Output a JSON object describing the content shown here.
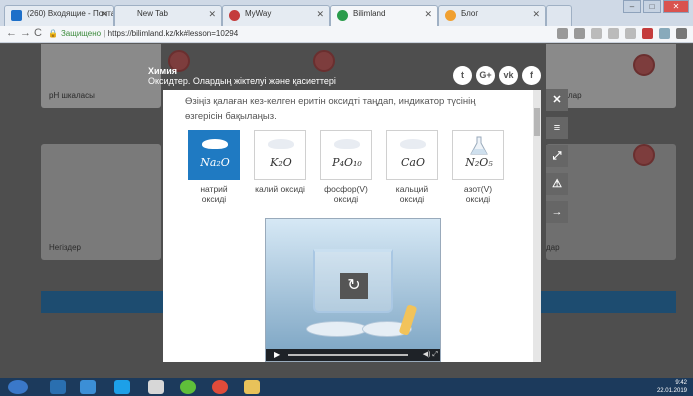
{
  "browser": {
    "tabs": [
      {
        "label": "(260) Входящие - Почта"
      },
      {
        "label": "New Tab"
      },
      {
        "label": "MyWay"
      },
      {
        "label": "Bilimland"
      },
      {
        "label": "Блог"
      }
    ],
    "url_secure": "Защищено",
    "url": "https://bilimland.kz/kk#lesson=10294"
  },
  "page": {
    "card_labels": [
      "pH шкаласы",
      "Негіздер"
    ],
    "card_right_fragments": [
      "лар",
      "дар"
    ]
  },
  "modal": {
    "subject": "Химия",
    "lesson_title": "Оксидтер. Олардың жіктелуі және қасиеттері",
    "instruction": "Өзіңіз қалаған кез-келген еритін оксидті таңдап, индикатор түсінің өзгерісін бақылаңыз.",
    "oxides": [
      {
        "formula": "Na₂O",
        "name": "натрий оксиді",
        "selected": true
      },
      {
        "formula": "K₂O",
        "name": "калий оксиді",
        "selected": false
      },
      {
        "formula": "P₄O₁₀",
        "name": "фосфор(V) оксиді",
        "selected": false
      },
      {
        "formula": "CaO",
        "name": "кальций оксиді",
        "selected": false
      },
      {
        "formula": "N₂O₅",
        "name": "азот(V) оксиді",
        "selected": false
      }
    ]
  },
  "social": [
    "twitter-icon",
    "google-plus-icon",
    "vk-icon",
    "facebook-icon"
  ],
  "side_buttons": [
    "close-icon",
    "menu-icon",
    "fullscreen-icon",
    "warning-icon",
    "next-icon"
  ],
  "taskbar": {
    "time": "9:42",
    "date": "22.01.2019"
  },
  "colors": {
    "selected_oxide": "#1f7ac2",
    "blue_band": "#1d4c70"
  }
}
